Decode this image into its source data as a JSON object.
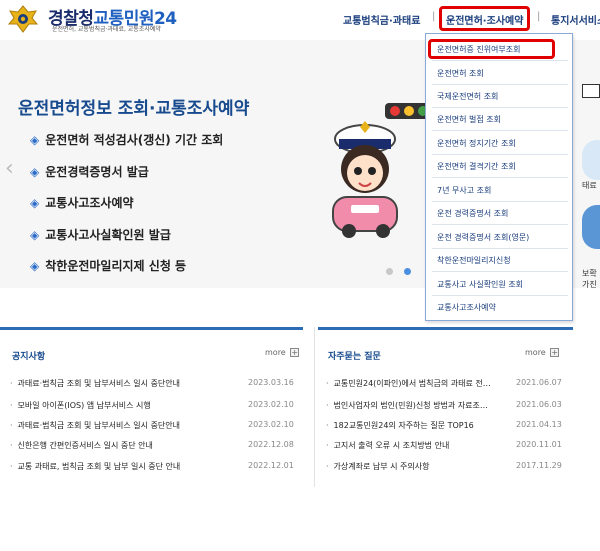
{
  "header": {
    "logo_main": "경찰청",
    "logo_accent": "교통민원24",
    "logo_sub": "운전면허, 교통범칙금·과태료, 교통조사예약",
    "nav": [
      {
        "label": "교통범칙금·과태료"
      },
      {
        "label": "운전면허·조사예약"
      },
      {
        "label": "통지서서비스"
      }
    ],
    "nav_separator": "|"
  },
  "banner": {
    "title": "운전면허정보 조회·교통조사예약",
    "items": [
      "운전면허 적성검사(갱신) 기간 조회",
      "운전경력증명서 발급",
      "교통사고조사예약",
      "교통사고사실확인원 발급",
      "착한운전마일리지제 신청 등"
    ],
    "bullet": "◈",
    "prev_arrow": "‹"
  },
  "right_strip": {
    "label_a": "태료",
    "label_b": "보확",
    "label_c": "가진단",
    "label_d": "리스"
  },
  "dropdown": {
    "items": [
      "운전면허증 진위여부조회",
      "운전면허 조회",
      "국제운전면허 조회",
      "운전면허 벌점 조회",
      "운전면허 정지기간 조회",
      "운전면허 결격기간 조회",
      "7년 무사고 조회",
      "운전 경력증명서 조회",
      "운전 경력증명서 조회(영문)",
      "착한운전마일리지신청",
      "교통사고 사실확인원 조회",
      "교통사고조사예약"
    ]
  },
  "notice": {
    "title": "공지사항",
    "more": "more",
    "plus": "+",
    "rows": [
      {
        "text": "과태료·범칙금 조회 및 납부서비스 일시 중단안내",
        "date": "2023.03.16"
      },
      {
        "text": "모바일 아이폰(IOS) 앱 납부서비스 시행",
        "date": "2023.02.10"
      },
      {
        "text": "과태료·범칙금 조회 및 납부서비스 일시 중단안내",
        "date": "2023.02.10"
      },
      {
        "text": "신한은행 간편인증서비스 일시 중단 안내",
        "date": "2022.12.08"
      },
      {
        "text": "교통 과태료, 범칙금 조회 및 납부 일시 중단 안내",
        "date": "2022.12.01"
      }
    ]
  },
  "faq": {
    "title": "자주묻는 질문",
    "more": "more",
    "plus": "+",
    "rows": [
      {
        "text": "교통민원24(이파인)에서 범칙금의 과태료 전…",
        "date": "2021.06.07"
      },
      {
        "text": "법인사업자의 법인(민원)신청 방법과 자료조…",
        "date": "2021.06.03"
      },
      {
        "text": "182교통민원24의 자주하는 질문 TOP16",
        "date": "2021.04.13"
      },
      {
        "text": "고지서 출력 오류 시 조치방법 안내",
        "date": "2020.11.01"
      },
      {
        "text": "가상계좌로 납부 시 주의사항",
        "date": "2017.11.29"
      }
    ],
    "bullet": "·"
  },
  "colors": {
    "brand_navy": "#1a2c6b",
    "brand_blue": "#1e5fbf",
    "highlight_red": "#e00000",
    "panel_blue": "#2b6cb5"
  }
}
